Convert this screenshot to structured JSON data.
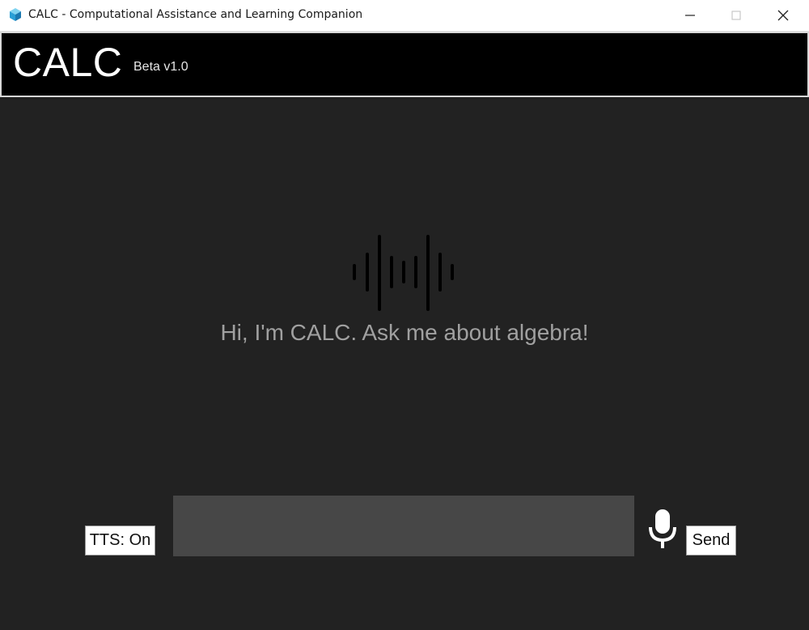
{
  "window": {
    "title": "CALC - Computational Assistance and Learning Companion",
    "icon": "cube-icon",
    "controls": [
      "minimize-icon",
      "maximize-icon",
      "close-icon"
    ]
  },
  "header": {
    "brand": "CALC",
    "version": "Beta v1.0"
  },
  "center": {
    "icon": "waveform-icon",
    "greeting": "Hi, I'm CALC. Ask me about algebra!"
  },
  "controls": {
    "tts_label": "TTS: On",
    "input_value": "",
    "mic_icon": "microphone-icon",
    "send_label": "Send"
  },
  "colors": {
    "background": "#222222",
    "header": "#000000",
    "input": "#474747",
    "greeting_text": "#a0a0a0"
  }
}
